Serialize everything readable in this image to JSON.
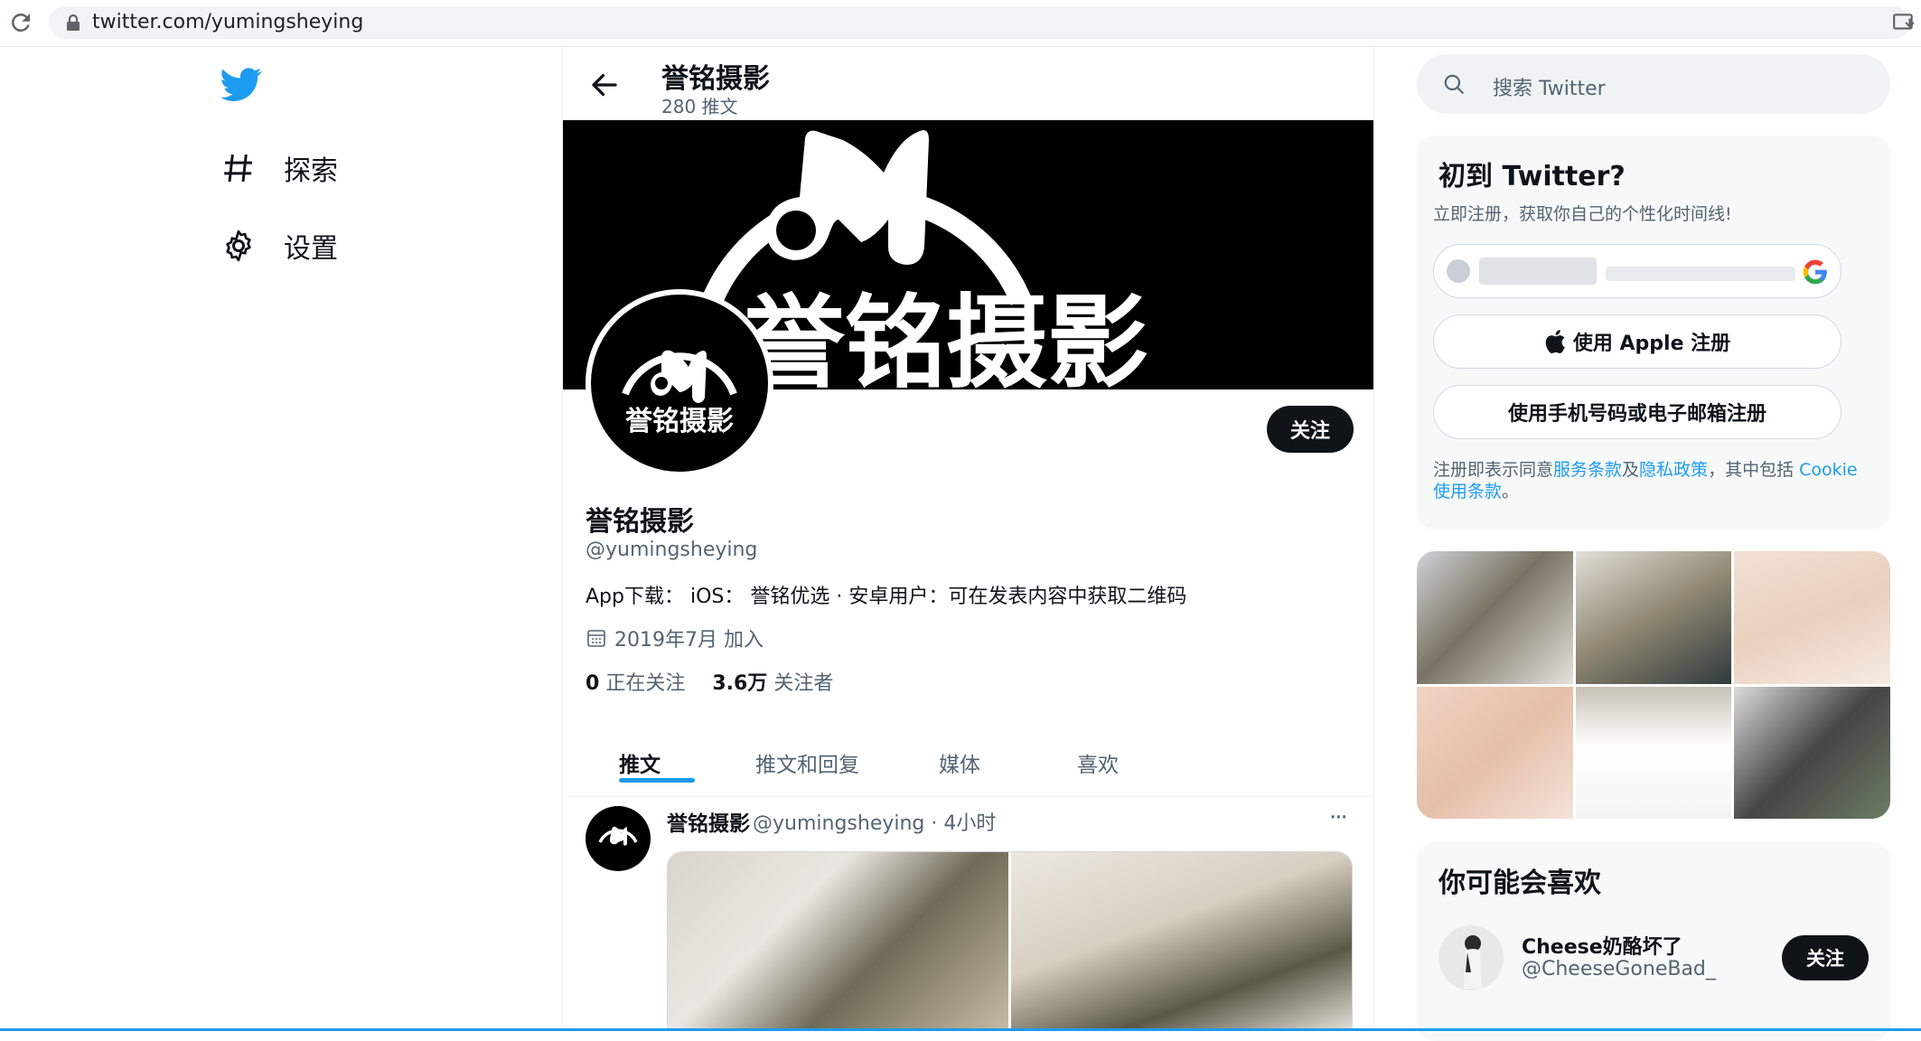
{
  "browser": {
    "url": "twitter.com/yumingsheying"
  },
  "nav": {
    "items": [
      {
        "label": "探索",
        "icon": "hashtag-icon"
      },
      {
        "label": "设置",
        "icon": "gear-icon"
      }
    ]
  },
  "header": {
    "name": "誉铭摄影",
    "tweet_count": "280 推文"
  },
  "banner": {
    "text": "誉铭摄影"
  },
  "profile": {
    "name": "誉铭摄影",
    "handle": "@yumingsheying",
    "bio": "App下载： iOS： 誉铭优选 · 安卓用户：可在发表内容中获取二维码",
    "joined": "2019年7月 加入",
    "following_count": "0",
    "following_label": "正在关注",
    "followers_count": "3.6万",
    "followers_label": "关注者",
    "follow_label": "关注",
    "avatar_text": "誉铭摄影"
  },
  "tabs": [
    "推文",
    "推文和回复",
    "媒体",
    "喜欢"
  ],
  "tweet": {
    "name": "誉铭摄影",
    "meta": "@yumingsheying · 4小时",
    "more": "···"
  },
  "search": {
    "placeholder": "搜索 Twitter"
  },
  "signup": {
    "title": "初到 Twitter?",
    "subtitle": "立即注册，获取你自己的个性化时间线!",
    "apple_label": "使用 Apple 注册",
    "phone_label": "使用手机号码或电子邮箱注册",
    "terms_prefix": "注册即表示同意",
    "terms_link1": "服务条款",
    "terms_and": "及",
    "terms_link2": "隐私政策",
    "terms_mid": "，其中包括 ",
    "terms_link3": "Cookie 使用条款",
    "terms_end": "。"
  },
  "who_to_follow": {
    "title": "你可能会喜欢",
    "items": [
      {
        "name": "Cheese奶酪坏了",
        "handle": "@CheeseGoneBad_",
        "follow_label": "关注"
      }
    ]
  },
  "colors": {
    "accent": "#1d9bf0",
    "text": "#0f1419",
    "secondary": "#536471",
    "banner_bg": "#000000"
  }
}
